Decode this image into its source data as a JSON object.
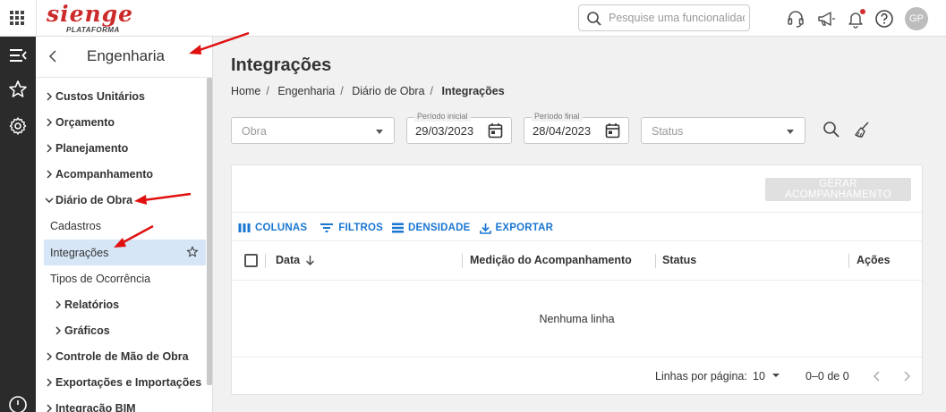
{
  "app": {
    "logo_text": "sienge",
    "logo_sub": "PLATAFORMA",
    "search_placeholder": "Pesquise uma funcionalidade.",
    "avatar_initials": "GP"
  },
  "nav": {
    "title": "Engenharia",
    "items": [
      {
        "label": "Custos Unitários"
      },
      {
        "label": "Orçamento"
      },
      {
        "label": "Planejamento"
      },
      {
        "label": "Acompanhamento"
      },
      {
        "label": "Diário de Obra"
      },
      {
        "label": "Cadastros"
      },
      {
        "label": "Integrações"
      },
      {
        "label": "Tipos de Ocorrência"
      },
      {
        "label": "Relatórios"
      },
      {
        "label": "Gráficos"
      },
      {
        "label": "Controle de Mão de Obra"
      },
      {
        "label": "Exportações e Importações"
      },
      {
        "label": "Integração BIM"
      }
    ]
  },
  "page": {
    "title": "Integrações",
    "breadcrumb": [
      "Home",
      "Engenharia",
      "Diário de Obra",
      "Integrações"
    ]
  },
  "filters": {
    "obra_placeholder": "Obra",
    "start_label": "Período inicial",
    "start_value": "29/03/2023",
    "end_label": "Período final",
    "end_value": "28/04/2023",
    "status_placeholder": "Status"
  },
  "grid": {
    "generate_button": "GERAR ACOMPANHAMENTO",
    "toolbar": {
      "columns": "COLUNAS",
      "filters": "FILTROS",
      "density": "DENSIDADE",
      "export": "EXPORTAR"
    },
    "columns": [
      "Data",
      "Medição do Acompanhamento",
      "Status",
      "Ações"
    ],
    "empty_message": "Nenhuma linha",
    "rows_per_page_label": "Linhas por página:",
    "rows_per_page_value": "10",
    "range_text": "0–0 de 0"
  },
  "colors": {
    "accent": "#1976d2",
    "brand": "#cc2b2b",
    "rail": "#2b2b2b",
    "active_nav": "#d6e6f7",
    "annotation_arrow": "#e01010"
  }
}
